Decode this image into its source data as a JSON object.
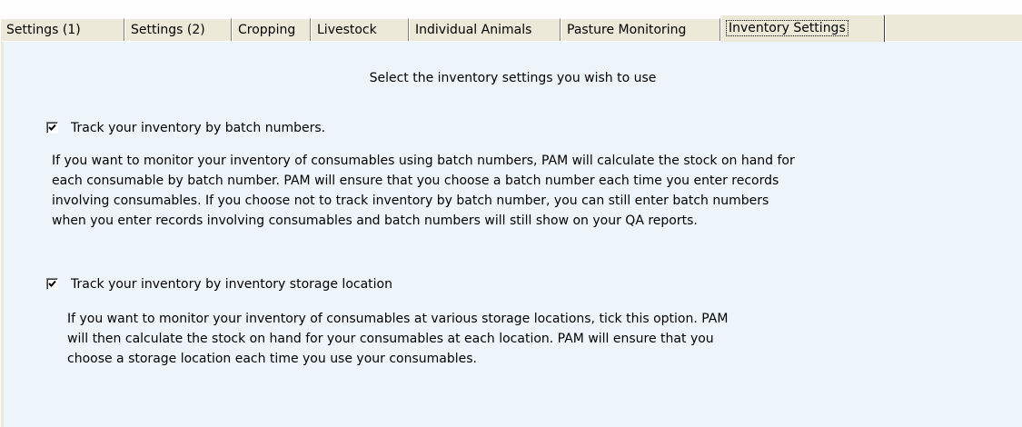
{
  "tabs": [
    {
      "label": "Settings (1)",
      "active": false
    },
    {
      "label": "Settings (2)",
      "active": false
    },
    {
      "label": "Cropping",
      "active": false
    },
    {
      "label": "Livestock",
      "active": false
    },
    {
      "label": "Individual Animals",
      "active": false
    },
    {
      "label": "Pasture Monitoring",
      "active": false
    },
    {
      "label": "Inventory Settings",
      "active": true
    }
  ],
  "panel": {
    "heading": "Select the inventory settings you wish to use",
    "options": [
      {
        "label": "Track your inventory by batch numbers.",
        "checked": true,
        "description_lines": [
          "If you want to monitor your inventory of consumables using batch numbers, PAM will calculate the stock on hand for",
          "each consumable by batch number. PAM will ensure that you choose a batch number each time you enter records",
          "involving consumables. If you choose not to track inventory by batch number, you can still enter batch numbers",
          "when you enter records involving consumables and batch numbers will still show on your QA reports."
        ]
      },
      {
        "label": "Track your inventory by inventory storage location",
        "checked": true,
        "description_lines": [
          "If you want to monitor your inventory of consumables at various storage locations, tick this option.  PAM",
          "will then calculate the stock on hand for your consumables at each location. PAM will ensure that you",
          "choose a storage location each time you use your consumables."
        ]
      }
    ]
  },
  "colors": {
    "panel_background": "#edf5fb",
    "tab_background": "#ece9d8"
  }
}
